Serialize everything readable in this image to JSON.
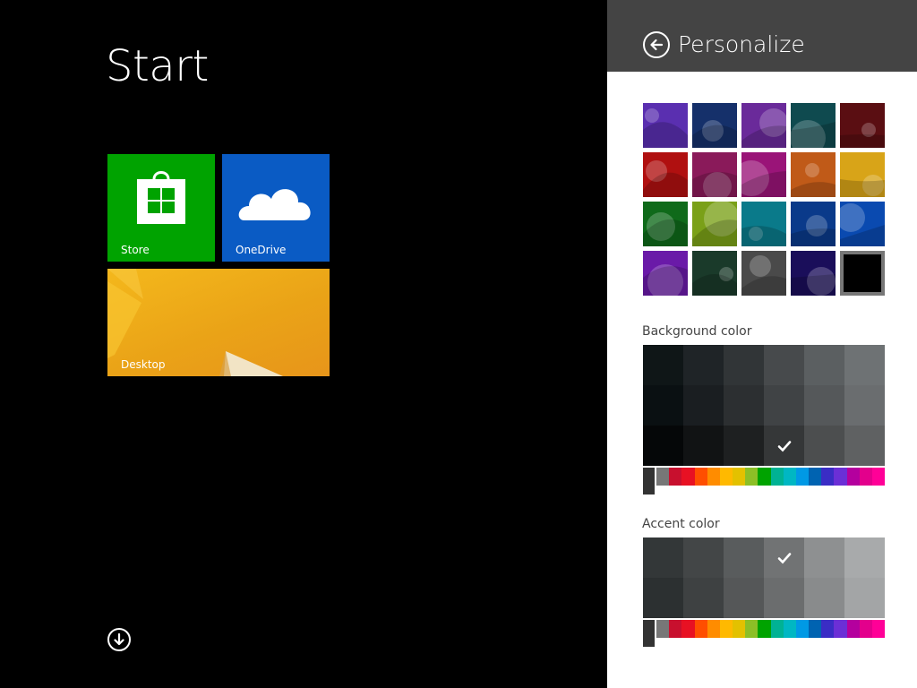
{
  "start": {
    "title": "Start",
    "tiles": [
      {
        "id": "store",
        "label": "Store",
        "icon": "store-bag-icon"
      },
      {
        "id": "onedrive",
        "label": "OneDrive",
        "icon": "cloud-icon"
      },
      {
        "id": "desktop",
        "label": "Desktop"
      }
    ],
    "apps_icon": "down-arrow-icon"
  },
  "panel": {
    "title": "Personalize",
    "back_icon": "back-arrow-icon",
    "background_color_label": "Background color",
    "accent_color_label": "Accent color",
    "patterns": [
      "#5a2fb0",
      "#15306a",
      "#6a2a9a",
      "#0f4a4f",
      "#5a0e12",
      "#b01010",
      "#8a1a5a",
      "#9a1478",
      "#c05a18",
      "#d8a418",
      "#0f6a1a",
      "#7aa018",
      "#0a7a8a",
      "#0a3a8a",
      "#0a4ab0",
      "#6a1aa8",
      "#1a3a2a",
      "#4a4a4a",
      "#1a0e5a",
      "#000000"
    ],
    "background_swatches": [
      [
        "#0f1617",
        "#1f2427",
        "#313537",
        "#474a4c",
        "#5b5f61",
        "#6e7274"
      ],
      [
        "#0a1012",
        "#1a1e21",
        "#2c2f31",
        "#404345",
        "#55585a",
        "#6a6d6f"
      ],
      [
        "#050708",
        "#111314",
        "#1e2021",
        "#353738",
        "#4c4e4f",
        "#5f6162"
      ]
    ],
    "background_selected": [
      2,
      3
    ],
    "accent_swatches": [
      [
        "#333738",
        "#434647",
        "#595c5d",
        "#717374",
        "#8e9091",
        "#a8aaab"
      ],
      [
        "#2c3031",
        "#3e4142",
        "#555758",
        "#6b6d6e",
        "#898b8c",
        "#a3a5a6"
      ]
    ],
    "accent_selected": [
      0,
      3
    ],
    "hues": [
      "#777777",
      "#c8102e",
      "#e81123",
      "#ff4e00",
      "#ff8c00",
      "#ffb900",
      "#e3c100",
      "#8cbf26",
      "#00a300",
      "#00b294",
      "#00b7c3",
      "#0099e5",
      "#0063b1",
      "#3a2dc5",
      "#6b2fd6",
      "#b4009e",
      "#e3008c",
      "#ff0097"
    ],
    "check_icon": "check-icon"
  }
}
